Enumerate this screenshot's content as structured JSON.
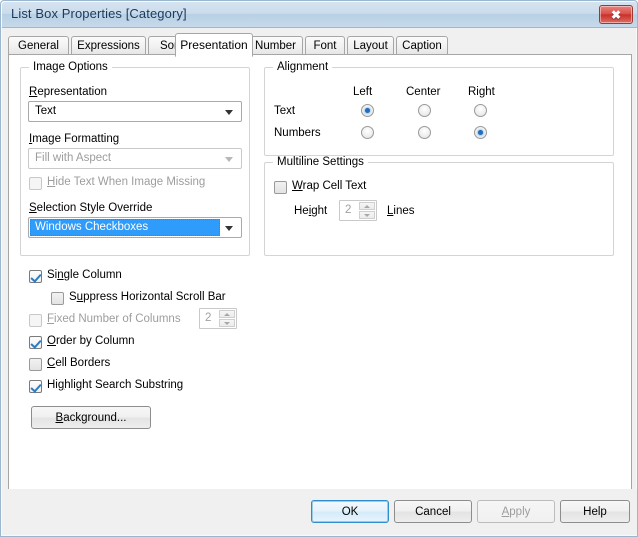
{
  "window": {
    "title": "List Box Properties [Category]",
    "close_label": "✖"
  },
  "tabs": [
    {
      "label": "General",
      "active": false
    },
    {
      "label": "Expressions",
      "active": false
    },
    {
      "label": "Sort",
      "active": false
    },
    {
      "label": "Presentation",
      "active": true
    },
    {
      "label": "Number",
      "active": false
    },
    {
      "label": "Font",
      "active": false
    },
    {
      "label": "Layout",
      "active": false
    },
    {
      "label": "Caption",
      "active": false
    }
  ],
  "image_options": {
    "group_title": "Image Options",
    "representation_label": "Representation",
    "representation_value": "Text",
    "image_formatting_label": "Image Formatting",
    "image_formatting_value": "Fill with Aspect",
    "hide_text_label": "Hide Text When Image Missing",
    "hide_text_checked": false,
    "hide_text_disabled": true,
    "selection_style_label": "Selection Style Override",
    "selection_style_value": "Windows Checkboxes"
  },
  "alignment": {
    "group_title": "Alignment",
    "col_left": "Left",
    "col_center": "Center",
    "col_right": "Right",
    "row_text": "Text",
    "row_numbers": "Numbers",
    "text_selected": "Left",
    "numbers_selected": "Right"
  },
  "multiline": {
    "group_title": "Multiline Settings",
    "wrap_label": "Wrap Cell Text",
    "wrap_checked": false,
    "height_label": "Height",
    "height_value": "2",
    "lines_label": "Lines"
  },
  "options": {
    "single_column_label": "Single Column",
    "single_column_checked": true,
    "suppress_scroll_label": "Suppress Horizontal Scroll Bar",
    "suppress_scroll_checked": false,
    "fixed_columns_label": "Fixed Number of Columns",
    "fixed_columns_checked": false,
    "fixed_columns_value": "2",
    "order_by_column_label": "Order by Column",
    "order_by_column_checked": true,
    "cell_borders_label": "Cell Borders",
    "cell_borders_checked": false,
    "highlight_search_label": "Highlight Search Substring",
    "highlight_search_checked": true,
    "background_label": "Background..."
  },
  "footer": {
    "ok": "OK",
    "cancel": "Cancel",
    "apply": "Apply",
    "help": "Help"
  },
  "colors": {
    "title_bar": "#c6d9ea",
    "selection_blue": "#2f9bfa",
    "check_blue": "#2b7bc4",
    "radio_blue": "#1d6fc0",
    "close_red": "#d9534c"
  }
}
